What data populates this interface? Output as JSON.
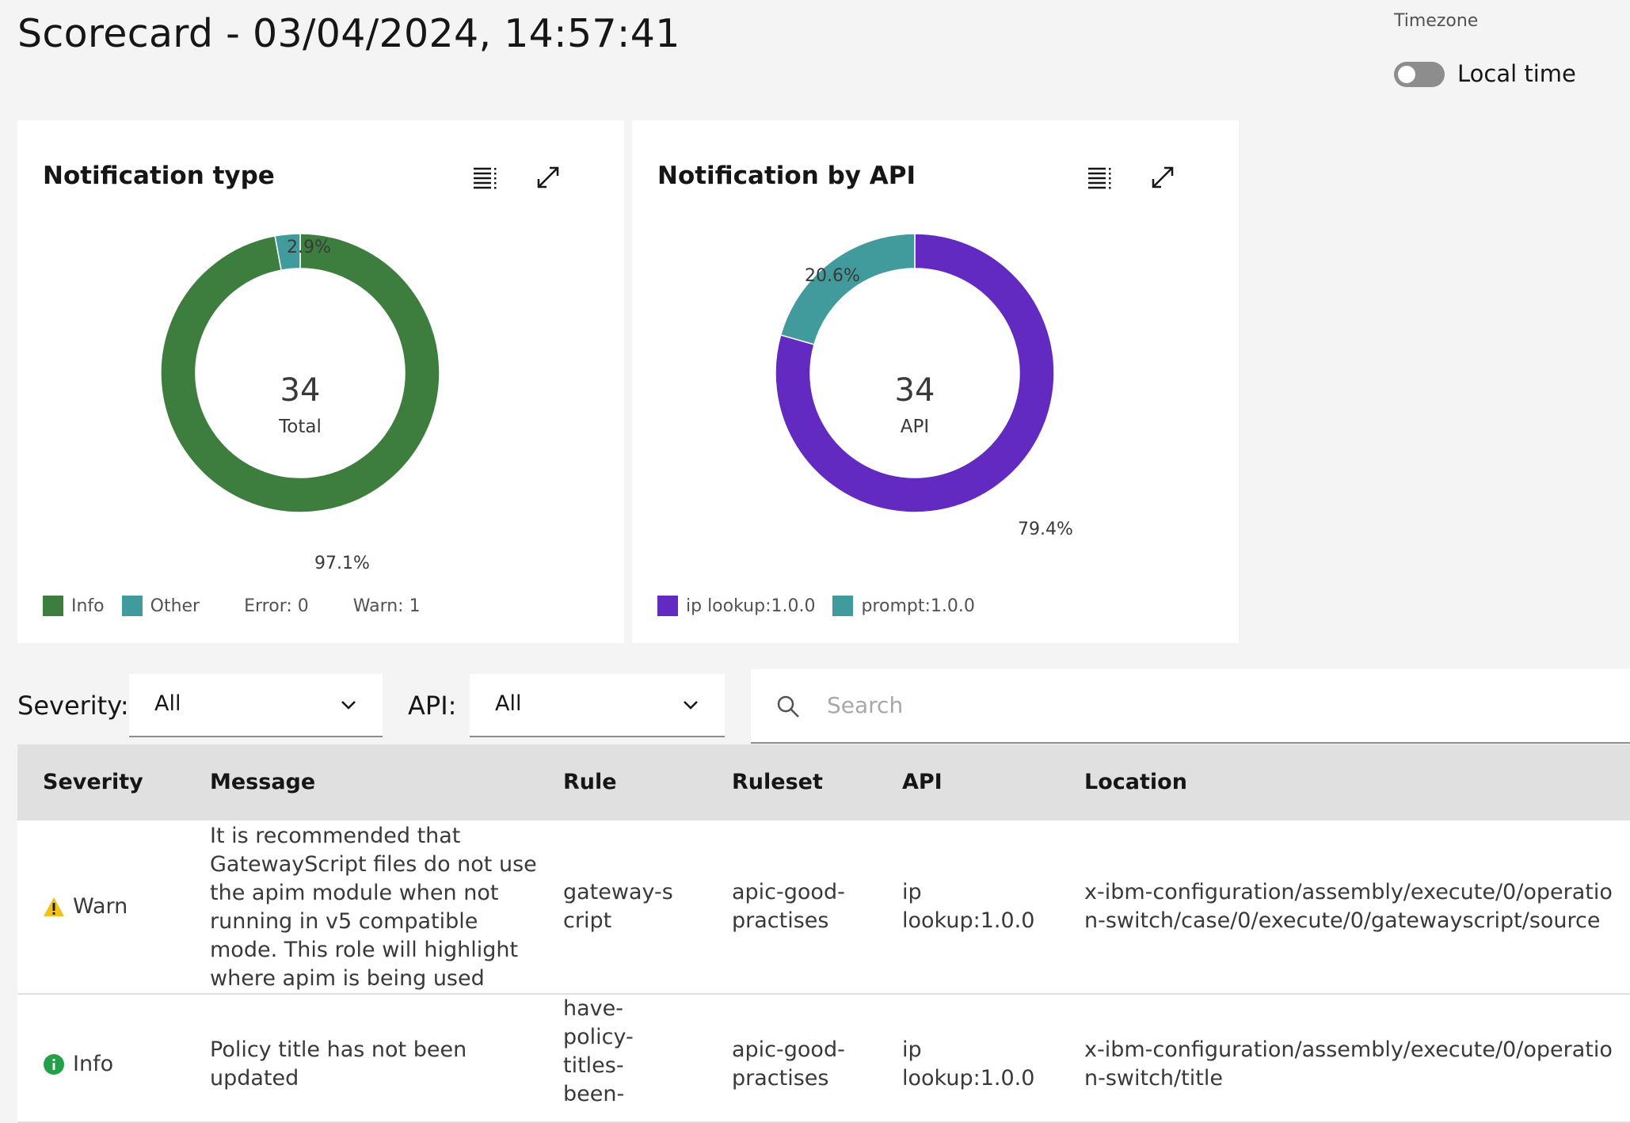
{
  "header": {
    "title": "Scorecard - 03/04/2024, 14:57:41",
    "timezone_label": "Timezone",
    "timezone_value": "Local time"
  },
  "cards": [
    {
      "title": "Notification type",
      "center_value": "34",
      "center_label": "Total",
      "labels": [
        "2.9%",
        "97.1%"
      ],
      "legend": [
        "Info",
        "Other"
      ],
      "extra": [
        "Error: 0",
        "Warn: 1"
      ],
      "colors": {
        "Info": "#3d7e3f",
        "Other": "#419b9c"
      }
    },
    {
      "title": "Notification by API",
      "center_value": "34",
      "center_label": "API",
      "labels": [
        "20.6%",
        "79.4%"
      ],
      "legend": [
        "ip lookup:1.0.0",
        "prompt:1.0.0"
      ],
      "colors": {
        "ip lookup:1.0.0": "#622ac0",
        "prompt:1.0.0": "#419b9c"
      }
    }
  ],
  "chart_data": [
    {
      "type": "pie",
      "title": "Notification type",
      "categories": [
        "Info",
        "Other"
      ],
      "values": [
        97.1,
        2.9
      ],
      "colors": [
        "#3d7e3f",
        "#419b9c"
      ],
      "center_text": "34 Total",
      "legend_position": "bottom-left"
    },
    {
      "type": "pie",
      "title": "Notification by API",
      "categories": [
        "ip lookup:1.0.0",
        "prompt:1.0.0"
      ],
      "values": [
        79.4,
        20.6
      ],
      "colors": [
        "#622ac0",
        "#419b9c"
      ],
      "center_text": "34 API",
      "legend_position": "bottom-left"
    }
  ],
  "filters": {
    "severity_label": "Severity:",
    "severity_value": "All",
    "api_label": "API:",
    "api_value": "All",
    "search_placeholder": "Search"
  },
  "table": {
    "headers": [
      "Severity",
      "Message",
      "Rule",
      "Ruleset",
      "API",
      "Location"
    ],
    "rows": [
      {
        "severity": "Warn",
        "severity_icon": "warning-icon",
        "message": "It is recommended that GatewayScript files do not use the apim module when not running in v5 compatible mode. This role will highlight where apim is being used",
        "rule": "gateway-script",
        "ruleset": "apic-good-practises",
        "api": "ip lookup:1.0.0",
        "location": "x-ibm-configuration/assembly/execute/0/operation-switch/case/0/execute/0/gatewayscript/source"
      },
      {
        "severity": "Info",
        "severity_icon": "info-icon",
        "message": "Policy title has not been updated",
        "rule": "have-policy-titles-been-",
        "ruleset": "apic-good-practises",
        "api": "ip lookup:1.0.0",
        "location": "x-ibm-configuration/assembly/execute/0/operation-switch/title"
      }
    ]
  }
}
